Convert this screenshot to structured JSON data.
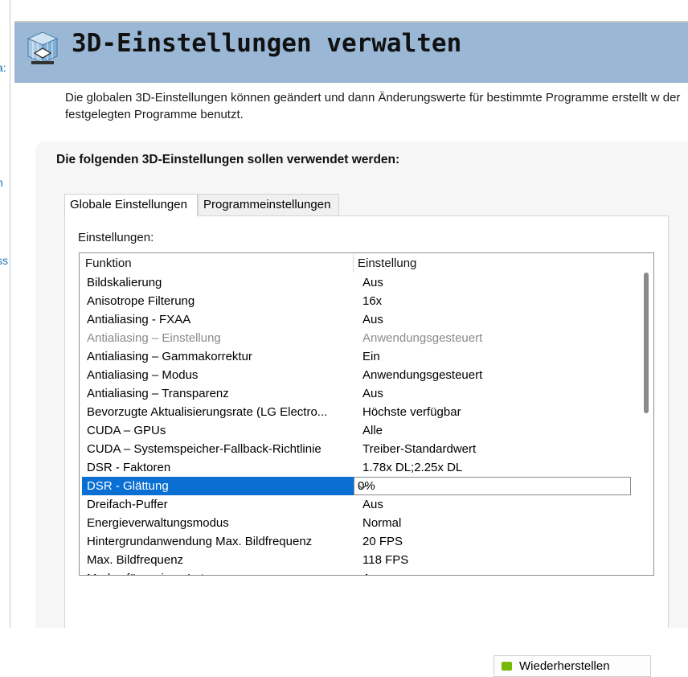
{
  "sidebar": {
    "fragments": [
      "a:",
      "n",
      "ss"
    ]
  },
  "header": {
    "title": "3D-Einstellungen verwalten",
    "icon": "3d-cube-icon"
  },
  "description": "Die globalen 3D-Einstellungen können geändert und dann Änderungswerte für bestimmte Programme erstellt w der festgelegten Programme benutzt.",
  "panel": {
    "heading": "Die folgenden 3D-Einstellungen sollen verwendet werden:",
    "tabs": [
      {
        "label": "Globale Einstellungen",
        "active": true
      },
      {
        "label": "Programmeinstellungen",
        "active": false
      }
    ],
    "settings_label": "Einstellungen:",
    "columns": {
      "function": "Funktion",
      "setting": "Einstellung"
    },
    "rows": [
      {
        "function": "Bildskalierung",
        "value": "Aus"
      },
      {
        "function": "Anisotrope Filterung",
        "value": "16x"
      },
      {
        "function": "Antialiasing - FXAA",
        "value": "Aus"
      },
      {
        "function": "Antialiasing – Einstellung",
        "value": "Anwendungsgesteuert",
        "disabled": true
      },
      {
        "function": "Antialiasing – Gammakorrektur",
        "value": "Ein"
      },
      {
        "function": "Antialiasing – Modus",
        "value": "Anwendungsgesteuert"
      },
      {
        "function": "Antialiasing – Transparenz",
        "value": "Aus"
      },
      {
        "function": "Bevorzugte Aktualisierungsrate (LG Electro...",
        "value": "Höchste verfügbar"
      },
      {
        "function": "CUDA – GPUs",
        "value": "Alle"
      },
      {
        "function": "CUDA – Systemspeicher-Fallback-Richtlinie",
        "value": "Treiber-Standardwert"
      },
      {
        "function": "DSR - Faktoren",
        "value": "1.78x DL;2.25x DL"
      },
      {
        "function": "DSR - Glättung",
        "value": "0%",
        "selected": true
      },
      {
        "function": "Dreifach-Puffer",
        "value": "Aus"
      },
      {
        "function": "Energieverwaltungsmodus",
        "value": "Normal"
      },
      {
        "function": "Hintergrundanwendung Max. Bildfrequenz",
        "value": "20 FPS"
      },
      {
        "function": "Max. Bildfrequenz",
        "value": "118 FPS"
      },
      {
        "function": "Modus für geringe Latenz",
        "value": "Aus"
      }
    ],
    "restore_button": {
      "label": "Wiederherstellen",
      "icon": "nvidia-icon"
    }
  },
  "colors": {
    "header_bg": "#9ab8d6",
    "selection": "#0a6fd3",
    "nvidia_green": "#76b900"
  }
}
